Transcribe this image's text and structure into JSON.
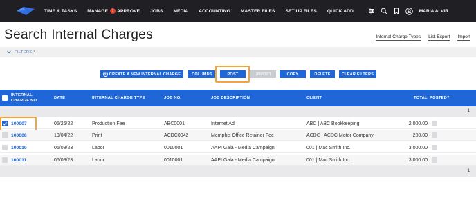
{
  "nav": {
    "items": [
      {
        "label": "TIME & TASKS"
      },
      {
        "label": "MANAGE",
        "badge": "!"
      },
      {
        "label": "APPROVE"
      },
      {
        "label": "JOBS"
      },
      {
        "label": "MEDIA"
      },
      {
        "label": "ACCOUNTING"
      },
      {
        "label": "MASTER FILES"
      },
      {
        "label": "SET UP FILES"
      },
      {
        "label": "QUICK ADD"
      }
    ],
    "icons": [
      "sliders-icon",
      "search-icon",
      "bookmark-icon",
      "user-circle-icon"
    ],
    "user_name": "MARIA ALVIR"
  },
  "page": {
    "title": "Search Internal Charges",
    "links": [
      "Internal Charge Types",
      "List Export",
      "Import"
    ]
  },
  "filters": {
    "label": "FILTERS *"
  },
  "actions": {
    "create_label": "CREATE A NEW INTERNAL CHARGE",
    "columns_label": "COLUMNS",
    "post_label": "POST",
    "unpost_label": "UNPOST",
    "copy_label": "COPY",
    "delete_label": "DELETE",
    "clear_filters_label": "CLEAR FILTERS"
  },
  "table": {
    "headers": {
      "charge_no_line1": "INTERNAL",
      "charge_no_line2": "CHARGE NO.",
      "date": "DATE",
      "type": "INTERNAL CHARGE TYPE",
      "job_no": "JOB NO.",
      "job_desc": "JOB DESCRIPTION",
      "client": "CLIENT",
      "total": "TOTAL",
      "posted": "POSTED?"
    },
    "group_count": "1",
    "rows": [
      {
        "charge_no": "100007",
        "date": "05/26/22",
        "type": "Production Fee",
        "job_no": "ABC0001",
        "job_desc": "Internet Ad",
        "client": "ABC | ABC Bookkeeping",
        "total": "2,000.00",
        "selected": true
      },
      {
        "charge_no": "100008",
        "date": "10/04/22",
        "type": "Print",
        "job_no": "ACDC0042",
        "job_desc": "Memphis Office Retainer Fee",
        "client": "ACDC | ACDC Motor Company",
        "total": "200.00",
        "selected": false
      },
      {
        "charge_no": "100010",
        "date": "06/08/23",
        "type": "Labor",
        "job_no": "0010001",
        "job_desc": "AAPI Gala - Media Campaign",
        "client": "001 | Mac Smith Inc.",
        "total": "3,000.00",
        "selected": false
      },
      {
        "charge_no": "100011",
        "date": "06/08/23",
        "type": "Labor",
        "job_no": "0010001",
        "job_desc": "AAPI Gala - Media Campaign",
        "client": "001 | Mac Smith Inc.",
        "total": "3,000.00",
        "selected": false
      }
    ],
    "footer_count": "1"
  },
  "colors": {
    "accent": "#1f66d8",
    "topbar": "#1f1f24",
    "highlight": "#f3a53a",
    "badge": "#e0422a"
  }
}
